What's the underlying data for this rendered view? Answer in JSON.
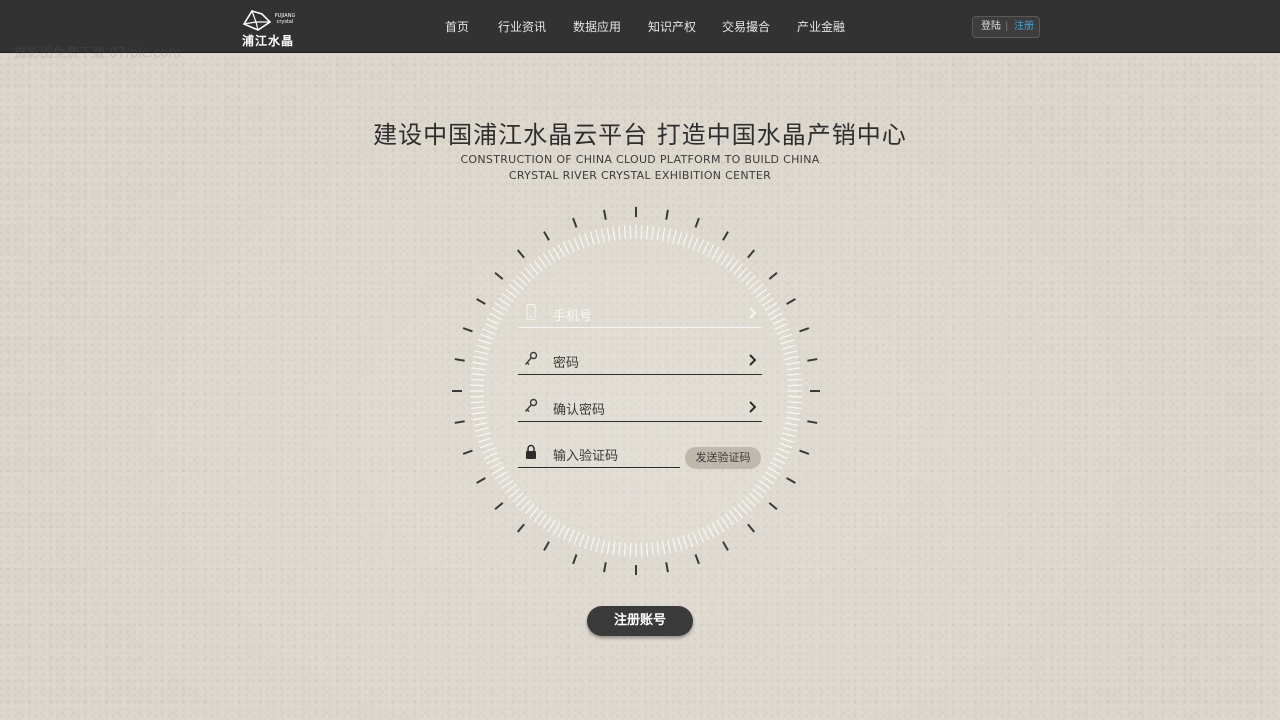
{
  "header": {
    "logo": {
      "tagline": "PUJIANG crystal",
      "name": "浦江水晶"
    },
    "nav": [
      "首页",
      "行业资讯",
      "数据应用",
      "知识产权",
      "交易撮合",
      "产业金融"
    ],
    "auth": {
      "login": "登陆",
      "separator": "|",
      "register": "注册"
    }
  },
  "watermark": "摄影图免费下载 07/pic.com",
  "hero": {
    "title_cn": "建设中国浦江水晶云平台  打造中国水晶产销中心",
    "title_en_line1": "CONSTRUCTION OF CHINA CLOUD PLATFORM TO BUILD CHINA",
    "title_en_line2": "CRYSTAL RIVER CRYSTAL EXHIBITION CENTER"
  },
  "form": {
    "phone": {
      "label": "手机号",
      "icon": "phone-icon"
    },
    "password": {
      "label": "密码",
      "icon": "key-icon"
    },
    "confirm_password": {
      "label": "确认密码",
      "icon": "key-icon"
    },
    "code": {
      "label": "输入验证码",
      "icon": "lock-icon"
    },
    "send_code": "发送验证码",
    "submit": "注册账号"
  },
  "colors": {
    "topbar": "#323232",
    "background": "#dcd6cb",
    "accent_link": "#3fa6d9",
    "button": "#3a3a3a"
  }
}
